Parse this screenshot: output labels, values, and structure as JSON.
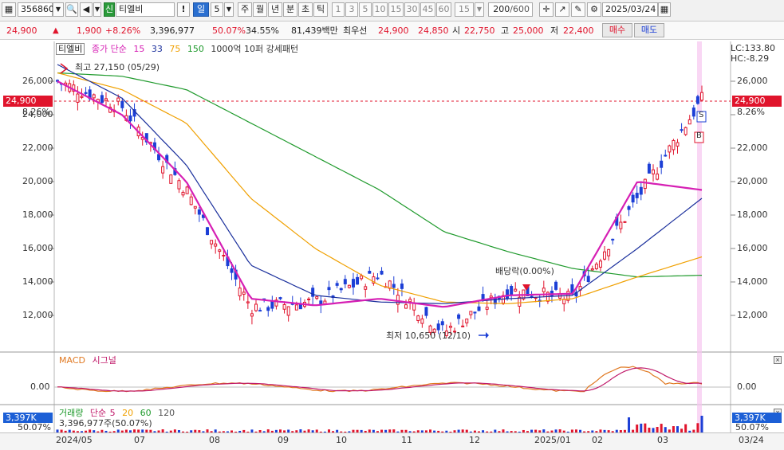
{
  "toolbar": {
    "code": "356860",
    "flag": "신",
    "name": "티엘비",
    "period_day": "일",
    "period_num": "5",
    "periods": [
      "주",
      "월",
      "년",
      "분",
      "초",
      "틱"
    ],
    "nums": [
      "1",
      "3",
      "5",
      "10",
      "15",
      "30",
      "45",
      "60",
      "15"
    ],
    "count": "200",
    "count_total": "/600",
    "date": "2025/03/24"
  },
  "quote": {
    "price": "24,900",
    "change": "1,900",
    "change_pct": "+8.26%",
    "volume": "3,396,977",
    "vol_ratio": "50.07%",
    "turnover": "34.55%",
    "amount": "81,439백만",
    "best_ask_label": "최우선",
    "best_ask": "24,900",
    "best_bid": "24,850",
    "open_label": "시",
    "open": "22,750",
    "high_label": "고",
    "high": "25,000",
    "low_label": "저",
    "low": "22,400",
    "buy": "매수",
    "sell": "매도"
  },
  "legend": {
    "name": "티엘비",
    "ma_label": "종가 단순",
    "ma15": "15",
    "ma33": "33",
    "ma75": "75",
    "ma150": "150",
    "extra": "1000억 10퍼 강세패턴"
  },
  "right_info": {
    "lc": "LC:133.80",
    "hc": "HC:-8.29"
  },
  "annotations": {
    "high": "최고 27,150 (05/29)",
    "low": "최저 10,650 (12/10)",
    "dividend": "배당락(0.00%)",
    "sell_mark": "S",
    "buy_mark": "B"
  },
  "price_axis": [
    "26,000",
    "24,000",
    "22,000",
    "20,000",
    "18,000",
    "16,000",
    "14,000",
    "12,000"
  ],
  "current_price_tag": "24,900",
  "current_pct_tag": "8.26%",
  "macd": {
    "label": "MACD",
    "signal": "시그널",
    "zero": "0.00"
  },
  "volume_pane": {
    "label": "거래량",
    "ma_label": "단순",
    "ma5": "5",
    "ma20": "20",
    "ma60": "60",
    "ma120": "120",
    "value": "3,396,977주(50.07%)",
    "tag": "3,397K",
    "pct": "50.07%"
  },
  "x_axis": [
    "2024/05",
    "07",
    "08",
    "09",
    "10",
    "11",
    "12",
    "2025/01",
    "02",
    "03",
    "03/24"
  ],
  "colors": {
    "up": "#e0142c",
    "down": "#1c3fd6",
    "ma15": "#d61fb4",
    "ma33": "#1a2f9c",
    "ma75": "#f0a000",
    "ma150": "#1f9a2c",
    "macd": "#e07820",
    "signal": "#c01a6a"
  },
  "chart_data": {
    "type": "line",
    "title": "티엘비",
    "x": [
      "2024/05",
      "07",
      "08",
      "09",
      "10",
      "11",
      "12",
      "2025/01",
      "02",
      "03",
      "03/24"
    ],
    "ylim": [
      10000,
      27500
    ],
    "series": [
      {
        "name": "종가",
        "values": [
          26000,
          24500,
          19500,
          12500,
          12800,
          14500,
          11000,
          13500,
          13000,
          19000,
          24900
        ]
      },
      {
        "name": "15",
        "values": [
          26000,
          24000,
          20000,
          13000,
          12600,
          13000,
          12500,
          13200,
          13300,
          20000,
          19500
        ]
      },
      {
        "name": "33",
        "values": [
          27000,
          25000,
          21000,
          15000,
          13200,
          12800,
          12700,
          13000,
          13200,
          16000,
          19000
        ]
      },
      {
        "name": "75",
        "values": [
          26500,
          25500,
          23500,
          19000,
          16000,
          13800,
          12800,
          12700,
          13000,
          14300,
          15500
        ]
      },
      {
        "name": "150",
        "values": [
          26500,
          26300,
          25500,
          23500,
          21500,
          19500,
          17000,
          15800,
          14800,
          14300,
          14400
        ]
      }
    ]
  }
}
